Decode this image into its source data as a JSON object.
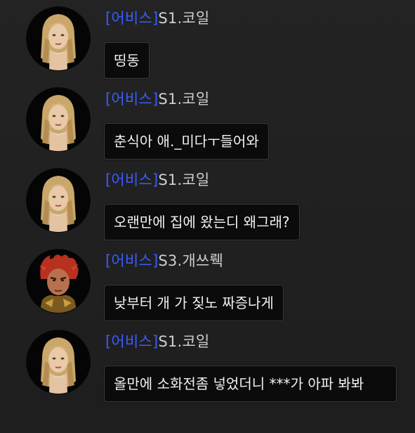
{
  "messages": [
    {
      "guild_tag": "[어비스]",
      "sender": "S1.코일",
      "text": "띵동",
      "avatar_icon": "blonde-female-portrait",
      "guild_color": "#3a5cff"
    },
    {
      "guild_tag": "[어비스]",
      "sender": "S1.코일",
      "text": "춘식아 애._미다ㅜ들어와",
      "avatar_icon": "blonde-female-portrait",
      "guild_color": "#3a5cff"
    },
    {
      "guild_tag": "[어비스]",
      "sender": "S1.코일",
      "text": "오랜만에 집에 왔는디 왜그래?",
      "avatar_icon": "blonde-female-portrait",
      "guild_color": "#3a5cff"
    },
    {
      "guild_tag": "[어비스]",
      "sender": "S3.개쓰뤡",
      "text": "낮부터 개 가 짖노 짜증나게",
      "avatar_icon": "red-haired-male-portrait",
      "guild_color": "#3a5cff"
    },
    {
      "guild_tag": "[어비스]",
      "sender": "S1.코일",
      "text": "올만에 소화전좀 넣었더니 ***가 아파 봐봐",
      "avatar_icon": "blonde-female-portrait",
      "guild_color": "#3a5cff"
    }
  ]
}
